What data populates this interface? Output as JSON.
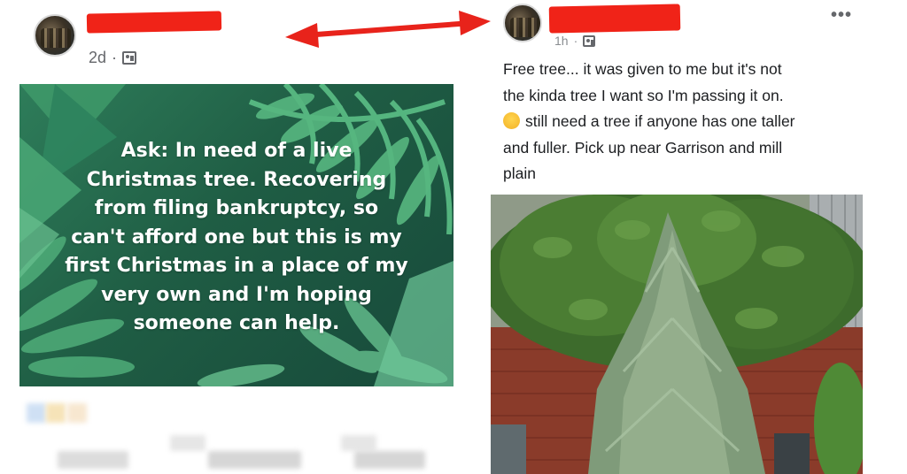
{
  "left_post": {
    "timestamp": "2d",
    "audience_icon": "group-icon",
    "ask_lines": [
      "Ask: In need of a live",
      "Christmas tree. Recovering",
      "from filing bankruptcy, so",
      "can't afford one but this is my",
      "first Christmas in a place of my",
      "very own and I'm hoping",
      "someone can help."
    ]
  },
  "right_post": {
    "timestamp": "1h",
    "audience_icon": "group-icon",
    "more_label": "•••",
    "text_lines": [
      "Free tree... it was given to me but it's not",
      "the kinda tree I want so I'm passing it on.",
      "still need a tree if anyone has one taller",
      "and fuller. Pick up near Garrison and mill",
      "plain"
    ],
    "emoji": "sad-face-emoji"
  },
  "colors": {
    "redaction": "#f02318",
    "arrow": "#e8231b",
    "card_green": "#1f5d44",
    "text_gray": "#65676b"
  }
}
